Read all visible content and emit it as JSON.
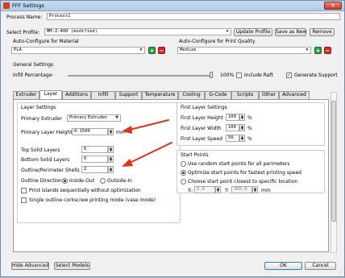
{
  "window": {
    "title": "FFF Settings",
    "close": "✕"
  },
  "process": {
    "label": "Process Name:",
    "value": "Process1"
  },
  "profile": {
    "label": "Select Profile:",
    "value": "MM-Z-400 (modified)",
    "update": "Update Profile",
    "save_new": "Save as New",
    "remove": "Remove"
  },
  "material": {
    "label": "Auto-Configure for Material",
    "value": "PLA"
  },
  "quality": {
    "label": "Auto-Configure for Print Quality",
    "value": "Medium"
  },
  "general": {
    "label": "General Settings",
    "infill_label": "Infill Percentage:",
    "infill_value": "100%",
    "infill_fraction": 1.0,
    "include_raft": "Include Raft",
    "include_raft_checked": false,
    "generate_support": "Generate Support",
    "generate_support_checked": true
  },
  "tabs": [
    {
      "label": "Extruder"
    },
    {
      "label": "Layer"
    },
    {
      "label": "Additions"
    },
    {
      "label": "Infill"
    },
    {
      "label": "Support"
    },
    {
      "label": "Temperature"
    },
    {
      "label": "Cooling"
    },
    {
      "label": "G-Code"
    },
    {
      "label": "Scripts"
    },
    {
      "label": "Other"
    },
    {
      "label": "Advanced"
    }
  ],
  "active_tab": "Layer",
  "layer_settings": {
    "title": "Layer Settings",
    "primary_extruder_label": "Primary Extruder",
    "primary_extruder_value": "Primary Extruder",
    "layer_height_label": "Primary Layer Height",
    "layer_height_value": "0.1500",
    "layer_height_unit": "mm",
    "top_label": "Top Solid Layers",
    "top_value": "6",
    "bottom_label": "Bottom Solid Layers",
    "bottom_value": "6",
    "shells_label": "Outline/Perimeter Shells",
    "shells_value": "2",
    "direction_label": "Outline Direction:",
    "inside_out": "Inside-Out",
    "outside_in": "Outside-In",
    "print_islands": "Print islands sequentially without optimization",
    "single_outline": "Single outline corkscrew printing mode (vase mode)"
  },
  "first_layer": {
    "title": "First Layer Settings",
    "height_label": "First Layer Height",
    "height_value": "100",
    "width_label": "First Layer Width",
    "width_value": "100",
    "speed_label": "First Layer Speed",
    "speed_value": "50",
    "unit": "%"
  },
  "start_points": {
    "title": "Start Points",
    "random": "Use random start points for all perimeters",
    "optimize": "Optimize start points for fastest printing speed",
    "closest": "Choose start point closest to specific location",
    "x_label": "X:",
    "x_value": "0.0",
    "y_label": "Y:",
    "y_value": "300.0",
    "unit": "mm"
  },
  "footer": {
    "hide_advanced": "Hide Advanced",
    "select_models": "Select Models",
    "ok": "OK",
    "cancel": "Cancel"
  },
  "colors": {
    "accent_red": "#e0301e",
    "plus_green": "#2e9a3a",
    "minus_red": "#cf2b2b"
  }
}
